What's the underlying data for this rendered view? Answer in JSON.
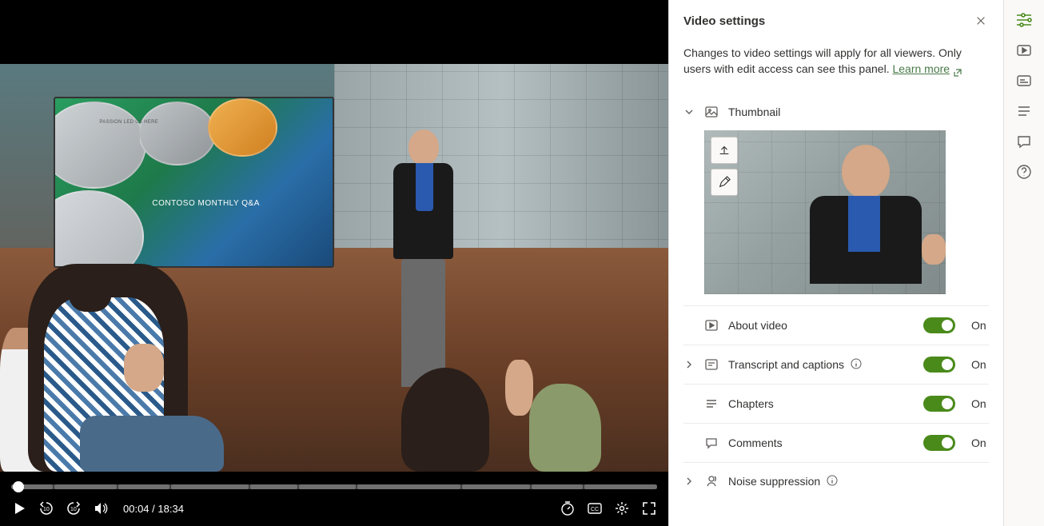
{
  "panel": {
    "title": "Video settings",
    "description": "Changes to video settings will apply for all viewers. Only users with edit access can see this panel. ",
    "learn_more": "Learn more"
  },
  "sections": {
    "thumbnail": {
      "label": "Thumbnail"
    },
    "about": {
      "label": "About video",
      "toggle": "On"
    },
    "transcript": {
      "label": "Transcript and captions",
      "toggle": "On"
    },
    "chapters": {
      "label": "Chapters",
      "toggle": "On"
    },
    "comments": {
      "label": "Comments",
      "toggle": "On"
    },
    "noise": {
      "label": "Noise suppression"
    }
  },
  "video": {
    "screen_heading": "CONTOSO MONTHLY Q&A",
    "screen_tagline": "PASSION LED US HERE",
    "current_time": "00:04",
    "total_time": "18:34",
    "time_sep": "  /  "
  }
}
